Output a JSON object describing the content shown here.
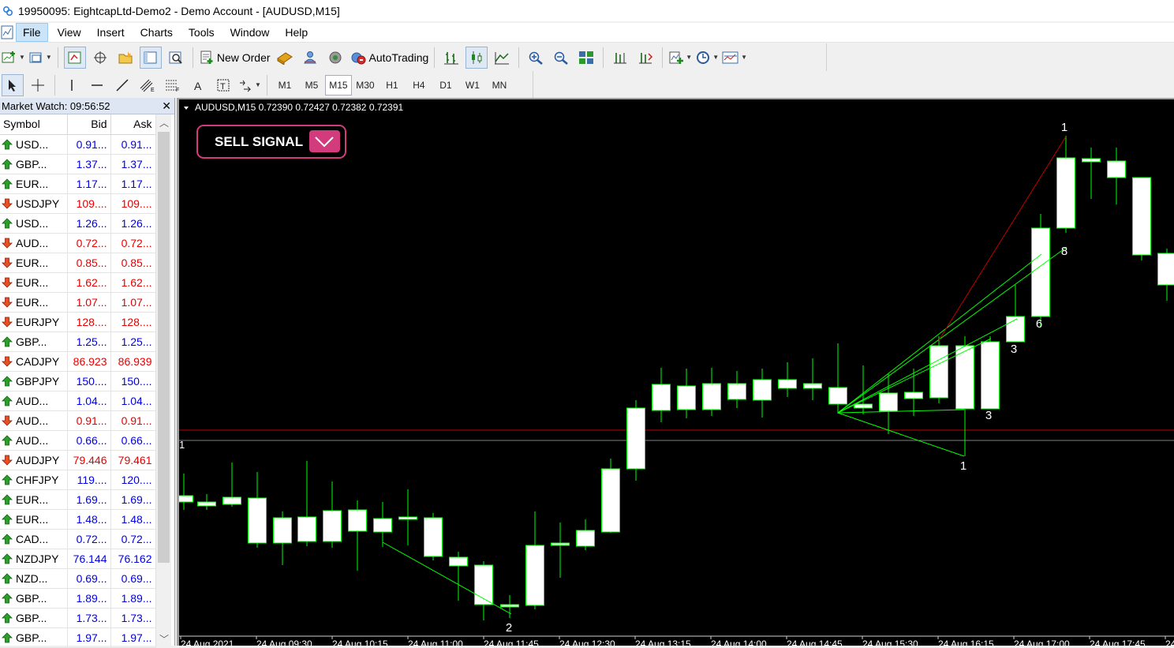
{
  "window": {
    "title": "19950095: EightcapLtd-Demo2 - Demo Account - [AUDUSD,M15]"
  },
  "menu": [
    "File",
    "View",
    "Insert",
    "Charts",
    "Tools",
    "Window",
    "Help"
  ],
  "toolbar": {
    "new_order_label": "New Order",
    "autotrading_label": "AutoTrading"
  },
  "timeframes": [
    "M1",
    "M5",
    "M15",
    "M30",
    "H1",
    "H4",
    "D1",
    "W1",
    "MN"
  ],
  "active_timeframe": "M15",
  "market_watch": {
    "title": "Market Watch: 09:56:52",
    "columns": [
      "Symbol",
      "Bid",
      "Ask"
    ],
    "rows": [
      {
        "symbol": "USD...",
        "bid": "0.91...",
        "ask": "0.91...",
        "dir": "up"
      },
      {
        "symbol": "GBP...",
        "bid": "1.37...",
        "ask": "1.37...",
        "dir": "up"
      },
      {
        "symbol": "EUR...",
        "bid": "1.17...",
        "ask": "1.17...",
        "dir": "up"
      },
      {
        "symbol": "USDJPY",
        "bid": "109....",
        "ask": "109....",
        "dir": "down"
      },
      {
        "symbol": "USD...",
        "bid": "1.26...",
        "ask": "1.26...",
        "dir": "up"
      },
      {
        "symbol": "AUD...",
        "bid": "0.72...",
        "ask": "0.72...",
        "dir": "down"
      },
      {
        "symbol": "EUR...",
        "bid": "0.85...",
        "ask": "0.85...",
        "dir": "down"
      },
      {
        "symbol": "EUR...",
        "bid": "1.62...",
        "ask": "1.62...",
        "dir": "down"
      },
      {
        "symbol": "EUR...",
        "bid": "1.07...",
        "ask": "1.07...",
        "dir": "down"
      },
      {
        "symbol": "EURJPY",
        "bid": "128....",
        "ask": "128....",
        "dir": "down"
      },
      {
        "symbol": "GBP...",
        "bid": "1.25...",
        "ask": "1.25...",
        "dir": "up"
      },
      {
        "symbol": "CADJPY",
        "bid": "86.923",
        "ask": "86.939",
        "dir": "down"
      },
      {
        "symbol": "GBPJPY",
        "bid": "150....",
        "ask": "150....",
        "dir": "up"
      },
      {
        "symbol": "AUD...",
        "bid": "1.04...",
        "ask": "1.04...",
        "dir": "up"
      },
      {
        "symbol": "AUD...",
        "bid": "0.91...",
        "ask": "0.91...",
        "dir": "down"
      },
      {
        "symbol": "AUD...",
        "bid": "0.66...",
        "ask": "0.66...",
        "dir": "up"
      },
      {
        "symbol": "AUDJPY",
        "bid": "79.446",
        "ask": "79.461",
        "dir": "down"
      },
      {
        "symbol": "CHFJPY",
        "bid": "119....",
        "ask": "120....",
        "dir": "up"
      },
      {
        "symbol": "EUR...",
        "bid": "1.69...",
        "ask": "1.69...",
        "dir": "up"
      },
      {
        "symbol": "EUR...",
        "bid": "1.48...",
        "ask": "1.48...",
        "dir": "up"
      },
      {
        "symbol": "CAD...",
        "bid": "0.72...",
        "ask": "0.72...",
        "dir": "up"
      },
      {
        "symbol": "NZDJPY",
        "bid": "76.144",
        "ask": "76.162",
        "dir": "up"
      },
      {
        "symbol": "NZD...",
        "bid": "0.69...",
        "ask": "0.69...",
        "dir": "up"
      },
      {
        "symbol": "GBP...",
        "bid": "1.89...",
        "ask": "1.89...",
        "dir": "up"
      },
      {
        "symbol": "GBP...",
        "bid": "1.73...",
        "ask": "1.73...",
        "dir": "up"
      },
      {
        "symbol": "GBP...",
        "bid": "1.97...",
        "ask": "1.97...",
        "dir": "up"
      }
    ]
  },
  "chart": {
    "header": "AUDUSD,M15  0.72390 0.72427 0.72382 0.72391",
    "signal_label": "SELL SIGNAL",
    "colors": {
      "background": "#000000",
      "bull_body": "#ffffff",
      "wick": "#00ff00",
      "red_line": "#c00000",
      "signal_border": "#d23c7c",
      "signal_button": "#d23c7c"
    },
    "time_labels": [
      "24 Aug 2021",
      "24 Aug 09:30",
      "24 Aug 10:15",
      "24 Aug 11:00",
      "24 Aug 11:45",
      "24 Aug 12:30",
      "24 Aug 13:15",
      "24 Aug 14:00",
      "24 Aug 14:45",
      "24 Aug 15:30",
      "24 Aug 16:15",
      "24 Aug 17:00",
      "24 Aug 17:45",
      "24"
    ],
    "annotations": [
      "1",
      "2",
      "8",
      "6",
      "3",
      "3",
      "1",
      "1"
    ]
  },
  "chart_data": {
    "type": "candlestick",
    "symbol": "AUDUSD",
    "timeframe": "M15",
    "ohlc_header": [
      0.7239,
      0.72427,
      0.72382,
      0.72391
    ],
    "x": [
      "24 Aug 2021",
      "24 Aug 09:30",
      "24 Aug 10:15",
      "24 Aug 11:00",
      "24 Aug 11:45",
      "24 Aug 12:30",
      "24 Aug 13:15",
      "24 Aug 14:00",
      "24 Aug 14:45",
      "24 Aug 15:30",
      "24 Aug 16:15",
      "24 Aug 17:00",
      "24 Aug 17:45"
    ],
    "grid": false
  }
}
